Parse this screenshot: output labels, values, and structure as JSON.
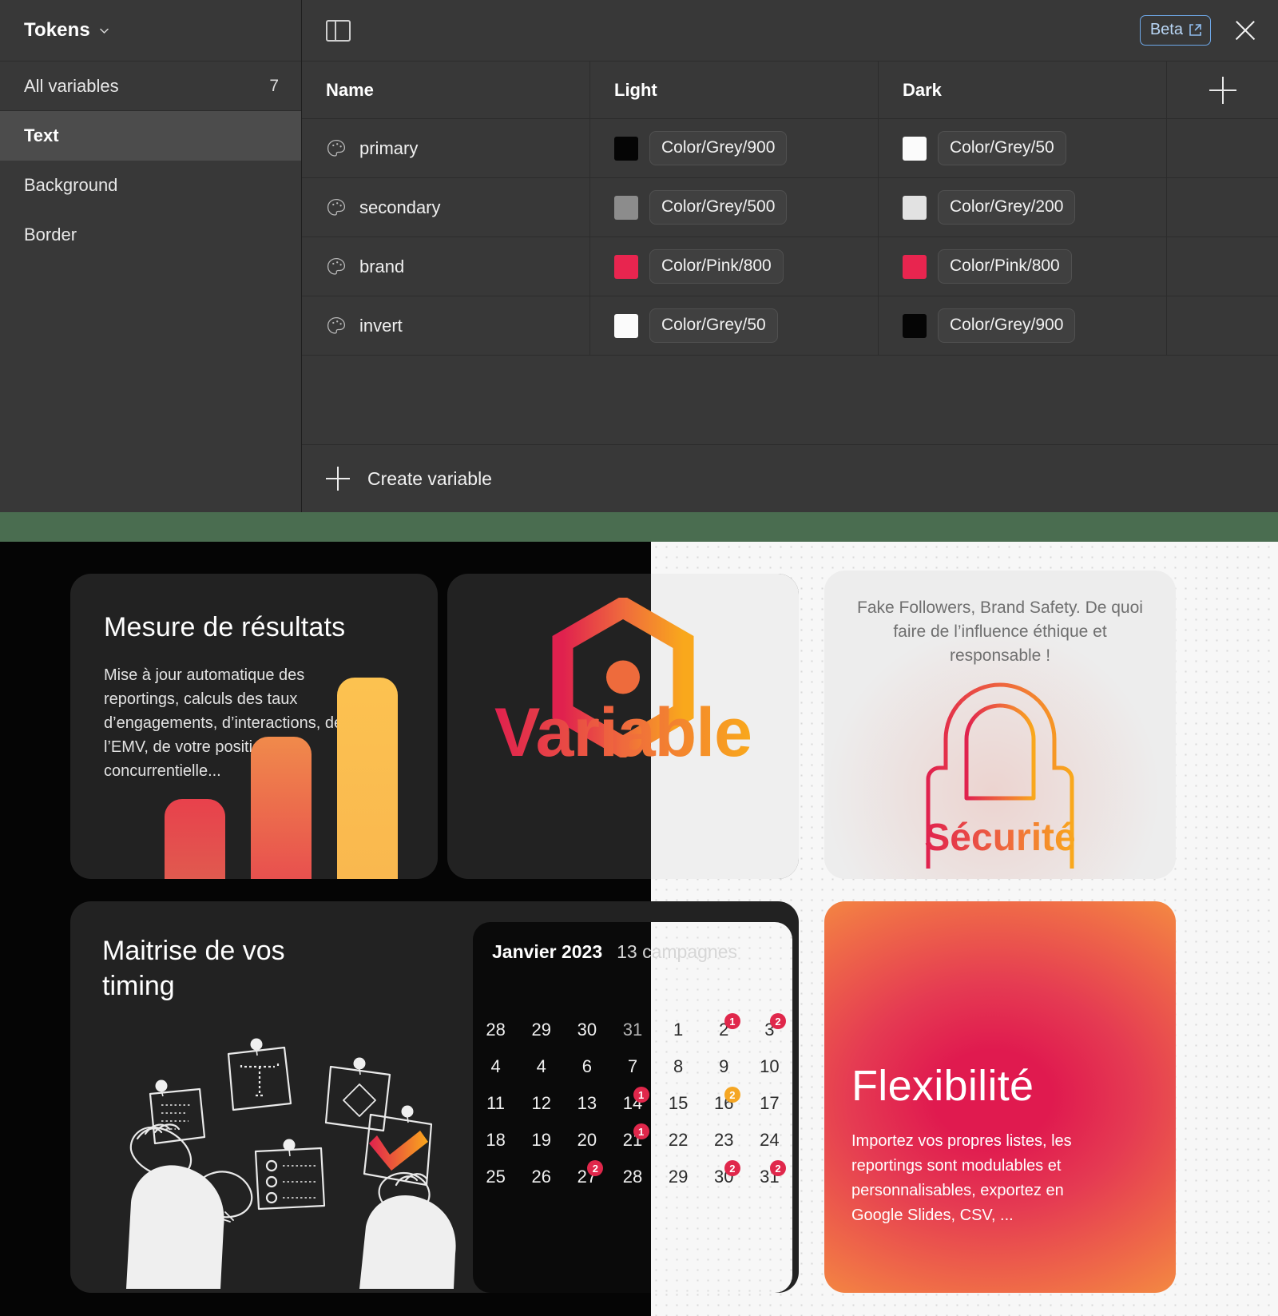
{
  "variables_panel": {
    "title": "Tokens",
    "title_chevron_icon": "chevron-down-icon",
    "panel_toggle_icon": "sidebar-panel-icon",
    "beta_label": "Beta",
    "beta_external_icon": "external-link-icon",
    "close_icon": "close-icon",
    "add_column_icon": "plus-icon",
    "sidebar": {
      "all_variables_label": "All variables",
      "all_variables_count": "7",
      "groups": [
        {
          "label": "Text"
        },
        {
          "label": "Background"
        },
        {
          "label": "Border"
        }
      ]
    },
    "table": {
      "columns": [
        "Name",
        "Light",
        "Dark"
      ],
      "rows": [
        {
          "icon": "palette-icon",
          "name": "primary",
          "light": {
            "token": "Color/Grey/900",
            "color": "#050505"
          },
          "dark": {
            "token": "Color/Grey/50",
            "color": "#fbfbfb"
          }
        },
        {
          "icon": "palette-icon",
          "name": "secondary",
          "light": {
            "token": "Color/Grey/500",
            "color": "#8c8c8c"
          },
          "dark": {
            "token": "Color/Grey/200",
            "color": "#e2e2e2"
          }
        },
        {
          "icon": "palette-icon",
          "name": "brand",
          "light": {
            "token": "Color/Pink/800",
            "color": "#e8254f"
          },
          "dark": {
            "token": "Color/Pink/800",
            "color": "#e8254f"
          }
        },
        {
          "icon": "palette-icon",
          "name": "invert",
          "light": {
            "token": "Color/Grey/50",
            "color": "#fbfbfb"
          },
          "dark": {
            "token": "Color/Grey/900",
            "color": "#050505"
          }
        }
      ]
    },
    "create_variable_label": "Create variable",
    "create_variable_icon": "plus-icon"
  },
  "board": {
    "mesure_card": {
      "title": "Mesure de résultats",
      "body": "Mise à jour automatique des reportings, calculs des taux d’engagements, d’interactions, de l’EMV, de votre position concurrentielle...",
      "chart": {
        "bars": [
          100,
          178,
          252
        ]
      }
    },
    "logo_card": {
      "wordmark": "Variable",
      "mark_icon": "hexagon-logo-icon"
    },
    "security_card": {
      "body": "Fake Followers, Brand Safety. De quoi faire de l’influence éthique et responsable !",
      "heading": "Sécurité",
      "icon": "lock-icon"
    },
    "timing_card": {
      "title": "Maitrise de vos timing",
      "illustration": "hands-pinning-notes-illustration"
    },
    "calendar_card": {
      "month": "Janvier 2023",
      "campaigns": "13 campagnes",
      "days": [
        {
          "n": "28",
          "muted": false
        },
        {
          "n": "29",
          "muted": false
        },
        {
          "n": "30",
          "muted": false
        },
        {
          "n": "31",
          "muted": true
        },
        {
          "n": "1",
          "muted": false
        },
        {
          "n": "2",
          "muted": false,
          "badge": "1",
          "badge_color": "red"
        },
        {
          "n": "3",
          "muted": false,
          "badge": "2",
          "badge_color": "red"
        },
        {
          "n": "4",
          "muted": false
        },
        {
          "n": "4",
          "muted": false
        },
        {
          "n": "6",
          "muted": false
        },
        {
          "n": "7",
          "muted": false
        },
        {
          "n": "8",
          "muted": false
        },
        {
          "n": "9",
          "muted": false
        },
        {
          "n": "10",
          "muted": false
        },
        {
          "n": "11",
          "muted": false
        },
        {
          "n": "12",
          "muted": false
        },
        {
          "n": "13",
          "muted": false
        },
        {
          "n": "14",
          "muted": false,
          "badge": "1",
          "badge_color": "red"
        },
        {
          "n": "15",
          "muted": false
        },
        {
          "n": "16",
          "muted": false,
          "badge": "2",
          "badge_color": "amber"
        },
        {
          "n": "17",
          "muted": false
        },
        {
          "n": "18",
          "muted": false
        },
        {
          "n": "19",
          "muted": false
        },
        {
          "n": "20",
          "muted": false
        },
        {
          "n": "21",
          "muted": false,
          "badge": "1",
          "badge_color": "red"
        },
        {
          "n": "22",
          "muted": false
        },
        {
          "n": "23",
          "muted": false
        },
        {
          "n": "24",
          "muted": false
        },
        {
          "n": "25",
          "muted": false
        },
        {
          "n": "26",
          "muted": false
        },
        {
          "n": "27",
          "muted": false,
          "badge": "2",
          "badge_color": "red"
        },
        {
          "n": "28",
          "muted": false
        },
        {
          "n": "29",
          "muted": false
        },
        {
          "n": "30",
          "muted": false,
          "badge": "2",
          "badge_color": "red"
        },
        {
          "n": "31",
          "muted": false,
          "badge": "2",
          "badge_color": "red"
        }
      ]
    },
    "flexibility_card": {
      "title": "Flexibilité",
      "body": "Importez vos propres listes, les reportings sont modulables et personnalisables, exportez en Google Slides, CSV, ..."
    }
  },
  "colors": {
    "brand_pink": "#e8254f",
    "brand_orange": "#f6983f",
    "brand_amber": "#f5a623",
    "panel_bg": "#383838",
    "board_dark": "#050505",
    "separator_green": "#4a6d50"
  }
}
